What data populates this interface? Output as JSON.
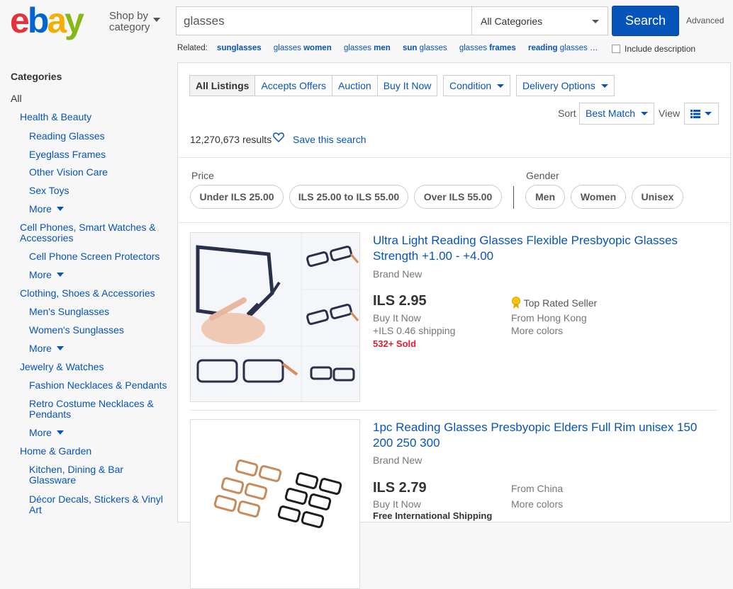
{
  "header": {
    "logo_text": "ebay",
    "shop_by_line1": "Shop by",
    "shop_by_line2": "category",
    "search_value": "glasses",
    "category_value": "All Categories",
    "search_button": "Search",
    "advanced": "Advanced",
    "related_label": "Related:",
    "related": [
      {
        "a": "sunglasses",
        "b": ""
      },
      {
        "a": "glasses",
        "b": "women"
      },
      {
        "a": "glasses",
        "b": "men"
      },
      {
        "a": "sun",
        "b": "glasses"
      },
      {
        "a": "glasses",
        "b": "frames"
      },
      {
        "a": "reading",
        "b": "glasses …"
      }
    ],
    "include_description": "Include description"
  },
  "sidebar": {
    "heading": "Categories",
    "all": "All",
    "items": [
      "Health & Beauty",
      "Reading Glasses",
      "Eyeglass Frames",
      "Other Vision Care",
      "Sex Toys",
      "More",
      "Cell Phones, Smart Watches & Accessories",
      "Cell Phone Screen Protectors",
      "More",
      "Clothing, Shoes & Accessories",
      "Men's Sunglasses",
      "Women's Sunglasses",
      "More",
      "Jewelry & Watches",
      "Fashion Necklaces & Pendants",
      "Retro Costume Necklaces & Pendants",
      "More",
      "Home & Garden",
      "Kitchen, Dining & Bar Glassware",
      "Décor Decals, Stickers & Vinyl Art"
    ]
  },
  "toolbar": {
    "tabs": [
      "All Listings",
      "Accepts Offers",
      "Auction",
      "Buy It Now"
    ],
    "condition": "Condition",
    "delivery": "Delivery Options",
    "sort_label": "Sort",
    "sort_value": "Best Match",
    "view_label": "View",
    "results": "12,270,673 results",
    "save_search": "Save this search"
  },
  "filters": {
    "price_label": "Price",
    "price_pills": [
      "Under ILS 25.00",
      "ILS 25.00 to ILS 55.00",
      "Over ILS 55.00"
    ],
    "gender_label": "Gender",
    "gender_pills": [
      "Men",
      "Women",
      "Unisex"
    ]
  },
  "listings": [
    {
      "title": "Ultra Light Reading Glasses Flexible Presbyopic Glasses Strength +1.00 - +4.00",
      "condition": "Brand New",
      "price": "ILS 2.95",
      "format": "Buy It Now",
      "shipping": "+ILS 0.46 shipping",
      "sold": "532+ Sold",
      "badge": "Top Rated Seller",
      "from": "From Hong Kong",
      "colors": "More colors"
    },
    {
      "title": "1pc Reading Glasses Presbyopic Elders Full Rim unisex 150 200 250 300",
      "condition": "Brand New",
      "price": "ILS 2.79",
      "format": "Buy It Now",
      "shipping": "Free International Shipping",
      "from": "From China",
      "colors": "More colors"
    }
  ],
  "colors": {
    "link": "#0654ba",
    "search_button": "#0654ba",
    "sold_red": "#dd1e31",
    "logo_e": "#e53238",
    "logo_b": "#0064d2",
    "logo_a": "#f5af02",
    "logo_y": "#86b817"
  }
}
